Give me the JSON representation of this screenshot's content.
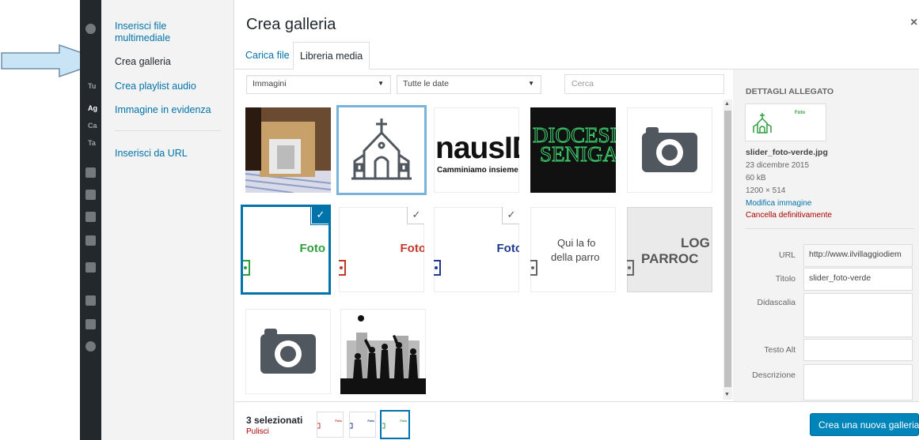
{
  "menu": {
    "items": [
      {
        "label": "Inserisci file multimediale"
      },
      {
        "label": "Crea galleria"
      },
      {
        "label": "Crea playlist audio"
      },
      {
        "label": "Immagine in evidenza"
      },
      {
        "label": "Inserisci da URL"
      }
    ],
    "wp_fragments": [
      "Tu",
      "Ag",
      "Ca",
      "Ta"
    ]
  },
  "frame": {
    "title": "Crea galleria",
    "close": "×",
    "tabs": [
      {
        "label": "Carica file"
      },
      {
        "label": "Libreria media"
      }
    ]
  },
  "toolbar": {
    "filter_type": "Immagini",
    "filter_date": "Tutte le date",
    "search_placeholder": "Cerca"
  },
  "grid": {
    "items": [
      {
        "name": "box-photo"
      },
      {
        "name": "church-icon"
      },
      {
        "name": "nausid",
        "text1": "nausID",
        "text2": "Camminiamo insieme"
      },
      {
        "name": "diocesi",
        "text1": "DIOCESI",
        "text2": "SENIGA"
      },
      {
        "name": "camera"
      },
      {
        "name": "foto-verde",
        "text": "Foto"
      },
      {
        "name": "foto-rosso",
        "text": "Foto"
      },
      {
        "name": "foto-blu",
        "text": "Foto"
      },
      {
        "name": "qui-la-foto",
        "text1": "Qui la fo",
        "text2": "della parro"
      },
      {
        "name": "logo-parrocchia",
        "text1": "LOG",
        "text2": "PARROC"
      },
      {
        "name": "camera-2"
      },
      {
        "name": "silhouettes"
      }
    ],
    "check_marks": [
      "✓",
      "✓",
      "✓"
    ]
  },
  "details": {
    "heading": "DETTAGLI ALLEGATO",
    "thumb_text": "Foto",
    "filename": "slider_foto-verde.jpg",
    "date": "23 dicembre 2015",
    "size": "60 kB",
    "dimensions": "1200 × 514",
    "edit_link": "Modifica immagine",
    "delete_link": "Cancella definitivamente",
    "fields": {
      "url_label": "URL",
      "url_value": "http://www.ilvillaggiodiem",
      "title_label": "Titolo",
      "title_value": "slider_foto-verde",
      "caption_label": "Didascalia",
      "alt_label": "Testo Alt",
      "description_label": "Descrizione"
    }
  },
  "bottom": {
    "selected_count": "3 selezionati",
    "clear": "Pulisci",
    "mini_text": "Foto",
    "create_button": "Crea una nuova galleria"
  },
  "colors": {
    "accent": "#0073aa",
    "button": "#0085ba",
    "danger": "#a00",
    "green": "#2e9e3e",
    "red": "#c0392b",
    "blue": "#1f3a8f",
    "arrow": "#c9e4f5"
  }
}
